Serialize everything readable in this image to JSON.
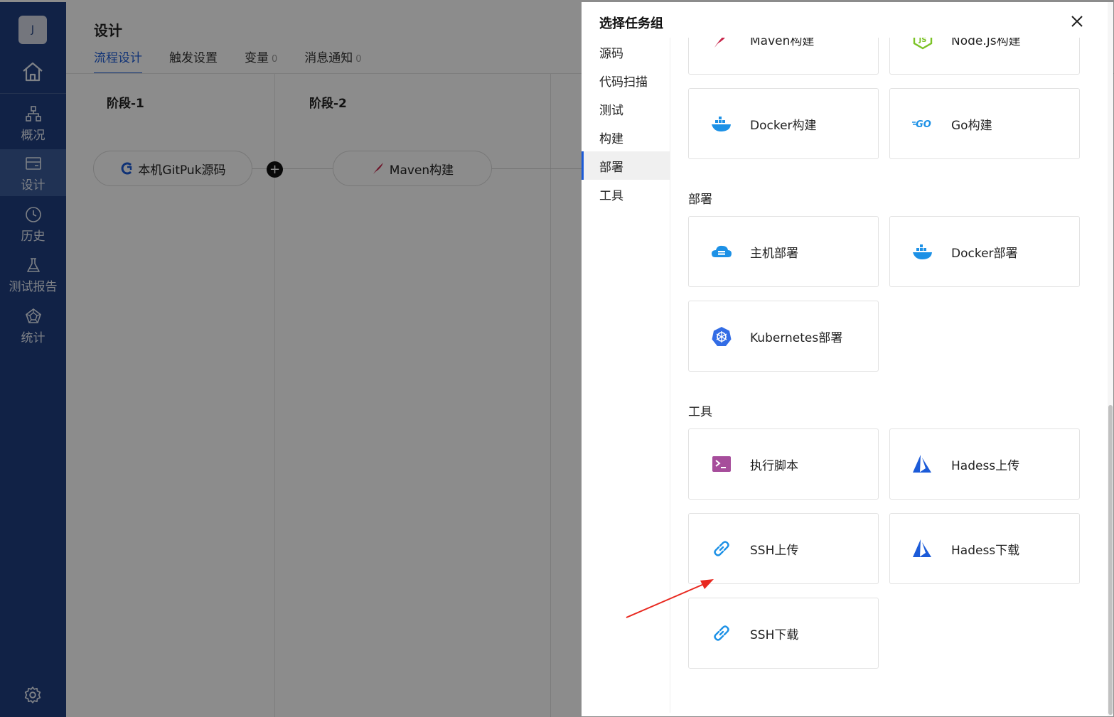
{
  "nav": {
    "avatar": "J",
    "items": [
      {
        "label": "概况",
        "icon": "sitemap-icon"
      },
      {
        "label": "设计",
        "icon": "layout-icon"
      },
      {
        "label": "历史",
        "icon": "clock-icon"
      },
      {
        "label": "测试报告",
        "icon": "flask-icon"
      },
      {
        "label": "统计",
        "icon": "pentagon-icon"
      }
    ]
  },
  "page": {
    "title": "设计",
    "tabs": [
      {
        "label": "流程设计",
        "count": ""
      },
      {
        "label": "触发设置",
        "count": ""
      },
      {
        "label": "变量",
        "count": "0"
      },
      {
        "label": "消息通知",
        "count": "0"
      }
    ],
    "stages": [
      {
        "title": "阶段-1",
        "task": "本机GitPuk源码"
      },
      {
        "title": "阶段-2",
        "task": "Maven构建"
      }
    ]
  },
  "drawer": {
    "title": "选择任务组",
    "categories": [
      "源码",
      "代码扫描",
      "测试",
      "构建",
      "部署",
      "工具"
    ],
    "active_category": "部署",
    "build_cards": [
      "Maven构建",
      "Node.Js构建",
      "Docker构建",
      "Go构建"
    ],
    "deploy_title": "部署",
    "deploy_cards": [
      "主机部署",
      "Docker部署",
      "Kubernetes部署"
    ],
    "tools_title": "工具",
    "tools_cards": [
      "执行脚本",
      "Hadess上传",
      "SSH上传",
      "Hadess下载",
      "SSH下载"
    ]
  },
  "colors": {
    "nav_bg": "#1f3f80",
    "accent": "#1c5bd8",
    "arrow": "#e8281f"
  }
}
